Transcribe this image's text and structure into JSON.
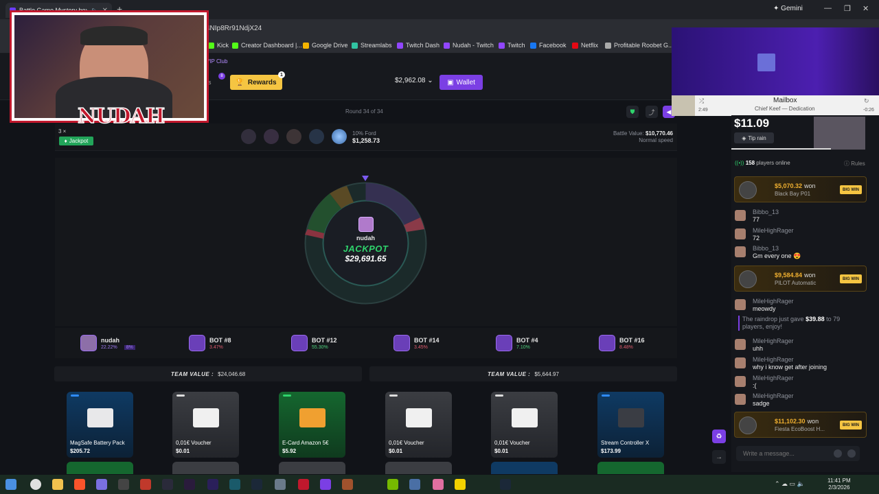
{
  "browser": {
    "tab_title": "Battle Game Mystery box...",
    "gemini_label": "Gemini",
    "url_fragment": "4NIp8Rr91NdjX24",
    "bookmarks": [
      {
        "label": "Kick",
        "color": "#53fc18"
      },
      {
        "label": "Creator Dashboard |...",
        "color": "#53fc18"
      },
      {
        "label": "Google Drive",
        "color": "#f4b400"
      },
      {
        "label": "Streamlabs",
        "color": "#31c3a2"
      },
      {
        "label": "Twitch Dash",
        "color": "#9146ff"
      },
      {
        "label": "Nudah - Twitch",
        "color": "#9146ff"
      },
      {
        "label": "Twitch",
        "color": "#9146ff"
      },
      {
        "label": "Facebook",
        "color": "#1877f2"
      },
      {
        "label": "Netflix",
        "color": "#e50914"
      },
      {
        "label": "Profitable Roobet G...",
        "color": "#aaaaaa"
      }
    ]
  },
  "site_header": {
    "vip_club": "VIP Club",
    "partial_label": "es",
    "rewards_label": "Rewards",
    "rewards_badge": "1",
    "small_badge": "8",
    "balance": "$2,962.08",
    "wallet_label": "Wallet",
    "round_text": "Round 34 of 34"
  },
  "battle": {
    "mode_text": "3 ×",
    "jackpot_pill": "Jackpot",
    "odds_label": "10% Ford",
    "odds_value": "$1,258.73",
    "battle_value_label": "Battle Value:",
    "battle_value": "$10,770.46",
    "speed": "Normal speed",
    "wheel_center": {
      "name": "nudah",
      "label": "JACKPOT",
      "amount": "$29,691.65"
    }
  },
  "players": [
    {
      "name": "nudah",
      "pct": "22.22%",
      "extra": "8%",
      "color": "p",
      "human": true
    },
    {
      "name": "BOT #8",
      "pct": "3.47%",
      "color": "r",
      "human": false
    },
    {
      "name": "BOT #12",
      "pct": "55.30%",
      "color": "g",
      "human": false
    },
    {
      "name": "BOT #14",
      "pct": "3.45%",
      "color": "r",
      "human": false
    },
    {
      "name": "BOT #4",
      "pct": "7.10%",
      "color": "g",
      "human": false
    },
    {
      "name": "BOT #16",
      "pct": "8.48%",
      "color": "r",
      "human": false
    }
  ],
  "teams": [
    {
      "label": "TEAM VALUE :",
      "value": "$24,046.68"
    },
    {
      "label": "TEAM VALUE :",
      "value": "$5,644.97"
    }
  ],
  "items": [
    {
      "name": "MagSafe Battery Pack",
      "price": "$205.72",
      "tag": "#2f8cff",
      "bg": "linear-gradient(180deg,#0f3a63,#0c2136)"
    },
    {
      "name": "0,01€ Voucher",
      "price": "$0.01",
      "tag": "#dddddd",
      "bg": "linear-gradient(180deg,#3b3d42,#23252a)"
    },
    {
      "name": "E-Card Amazon 5€",
      "price": "$5.92",
      "tag": "#2fd36c",
      "bg": "linear-gradient(180deg,#15672f,#0f3a1e)"
    },
    {
      "name": "0,01€ Voucher",
      "price": "$0.01",
      "tag": "#dddddd",
      "bg": "linear-gradient(180deg,#3b3d42,#23252a)"
    },
    {
      "name": "0,01€ Voucher",
      "price": "$0.01",
      "tag": "#dddddd",
      "bg": "linear-gradient(180deg,#3b3d42,#23252a)"
    },
    {
      "name": "Stream Controller X",
      "price": "$173.99",
      "tag": "#2f8cff",
      "bg": "linear-gradient(180deg,#0f3a63,#0c2136)"
    }
  ],
  "music": {
    "title": "Mailbox",
    "artist": "Chief Keef — Dedication",
    "elapsed": "2:49",
    "remaining": "-0:26"
  },
  "chat": {
    "tip_amount": "$11.09",
    "tip_rain_label": "Tip rain",
    "online_count": "158",
    "online_text": "players online",
    "rules_label": "Rules",
    "wins": [
      {
        "amount": "$5,070.32",
        "won": "won",
        "item": "Black Bay P01",
        "badge": "BIG WIN"
      },
      {
        "amount": "$9,584.84",
        "won": "won",
        "item": "PILOT Automatic",
        "badge": "BIG WIN"
      },
      {
        "amount": "$11,102.30",
        "won": "won",
        "item": "Fiesta EcoBoost H...",
        "badge": "BIG WIN"
      }
    ],
    "messages": [
      {
        "user": "Bibbo_13",
        "text": "77"
      },
      {
        "user": "MileHighRager",
        "text": "72"
      },
      {
        "user": "Bibbo_13",
        "text": "Gm every one 😍"
      },
      {
        "user": "MileHighRager",
        "text": "meowdy"
      },
      {
        "user": "MileHighRager",
        "text": "uhh"
      },
      {
        "user": "MileHighRager",
        "text": "why i know get after joining"
      },
      {
        "user": "MileHighRager",
        "text": ":("
      },
      {
        "user": "MileHighRager",
        "text": "sadge"
      }
    ],
    "raindrop_pre": "The raindrop just gave",
    "raindrop_amount": "$39.88",
    "raindrop_post": "to 79 players, enjoy!",
    "input_placeholder": "Write a message..."
  },
  "stream_overlay": {
    "name": "NUDAH"
  },
  "taskbar": {
    "time": "11:41 PM",
    "date": "2/3/2026"
  }
}
